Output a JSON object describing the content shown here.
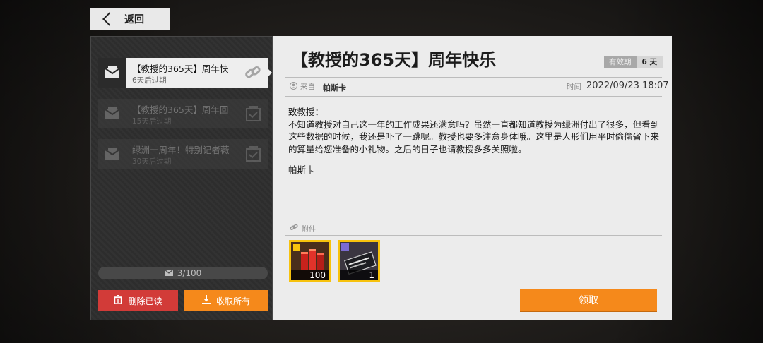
{
  "nav": {
    "back_label": "返回"
  },
  "mail_list": [
    {
      "title": "【教授的365天】周年快",
      "expiry": "6天后过期",
      "state": "active",
      "icon_right": "link-icon"
    },
    {
      "title": "【教授的365天】周年回",
      "expiry": "15天后过期",
      "state": "read",
      "icon_right": "checkbox-icon"
    },
    {
      "title": "绿洲一周年！特别记者薇",
      "expiry": "30天后过期",
      "state": "read",
      "icon_right": "checkbox-icon"
    }
  ],
  "mail_count": "3/100",
  "actions": {
    "delete_read": "删除已读",
    "collect_all": "收取所有"
  },
  "mail": {
    "title": "【教授的365天】周年快乐",
    "validity_label": "有效期",
    "validity_value": "6 天",
    "from_label": "来自",
    "sender": "帕斯卡",
    "time_label": "时间",
    "time_value": "2022/09/23 18:07",
    "greeting": "致教授：",
    "body": "不知道教授对自己这一年的工作成果还满意吗？虽然一直都知道教授为绿洲付出了很多，但看到这些数据的时候，我还是吓了一跳呢。教授也要多注意身体哦。这里是人形们用平时偷偷省下来的算量给您准备的小礼物。之后的日子也请教授多多关照啦。",
    "signature": "帕斯卡",
    "attachments_label": "附件",
    "attachments": [
      {
        "icon": "red-cubes-item-icon",
        "qty": "100"
      },
      {
        "icon": "instruction-card-item-icon",
        "qty": "1"
      }
    ],
    "claim_label": "领取"
  },
  "colors": {
    "accent_orange": "#f5891b",
    "delete_red": "#d23b38",
    "item_border": "#f7c20d"
  }
}
